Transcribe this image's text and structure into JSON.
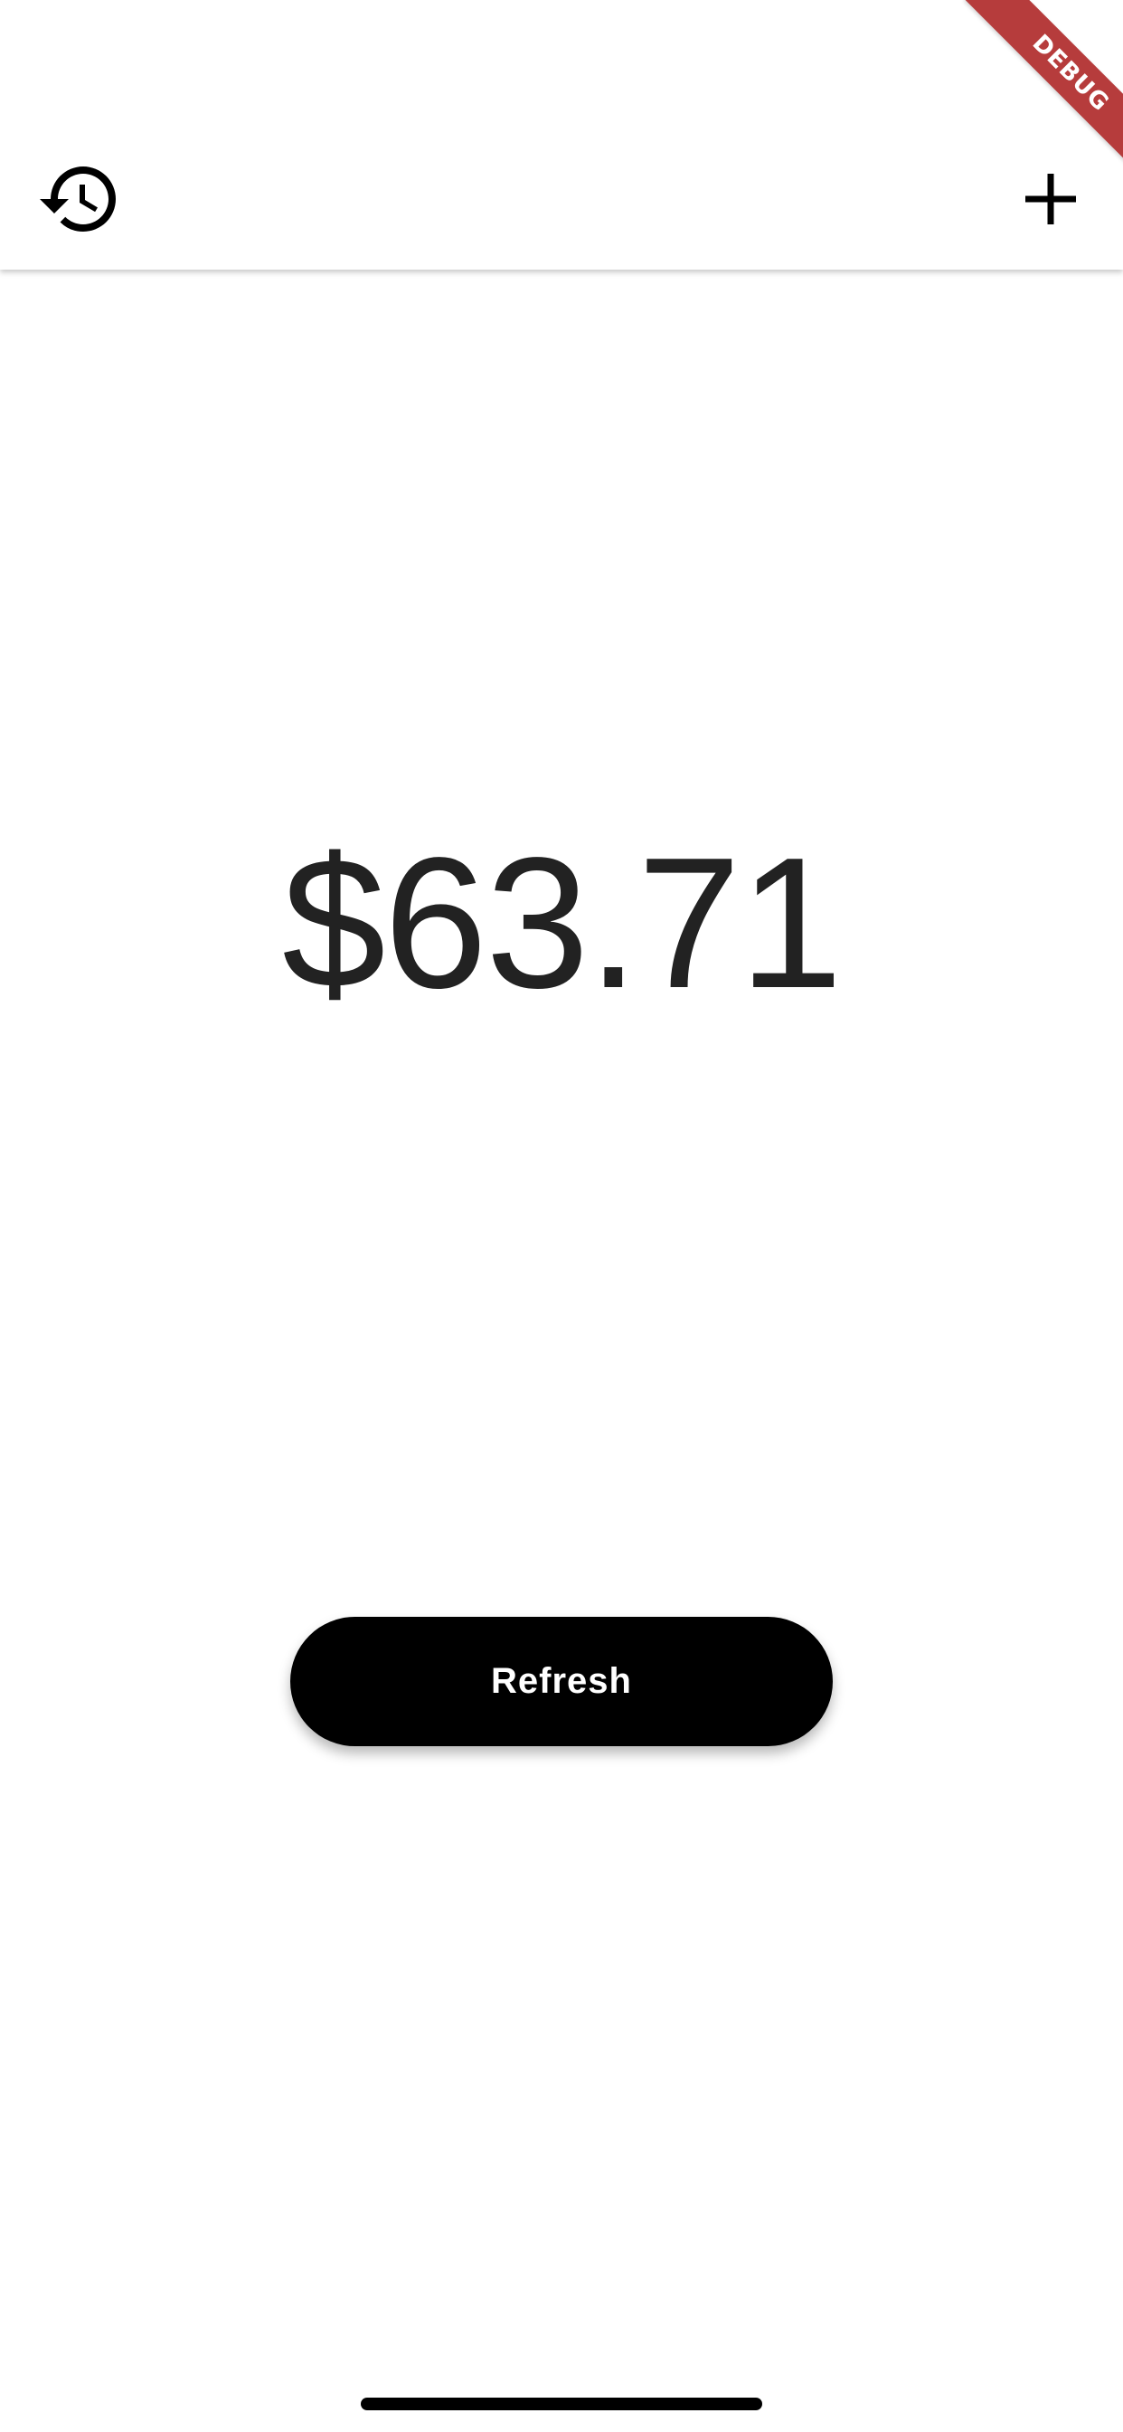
{
  "app_bar": {
    "history_icon": "history-icon",
    "add_icon": "plus-icon"
  },
  "debug_banner": {
    "label": "DEBUG",
    "color": "#b63c3c"
  },
  "main": {
    "price": "$63.71"
  },
  "actions": {
    "refresh_label": "Refresh"
  },
  "colors": {
    "background": "#ffffff",
    "button": "#000000",
    "text": "#222222"
  }
}
